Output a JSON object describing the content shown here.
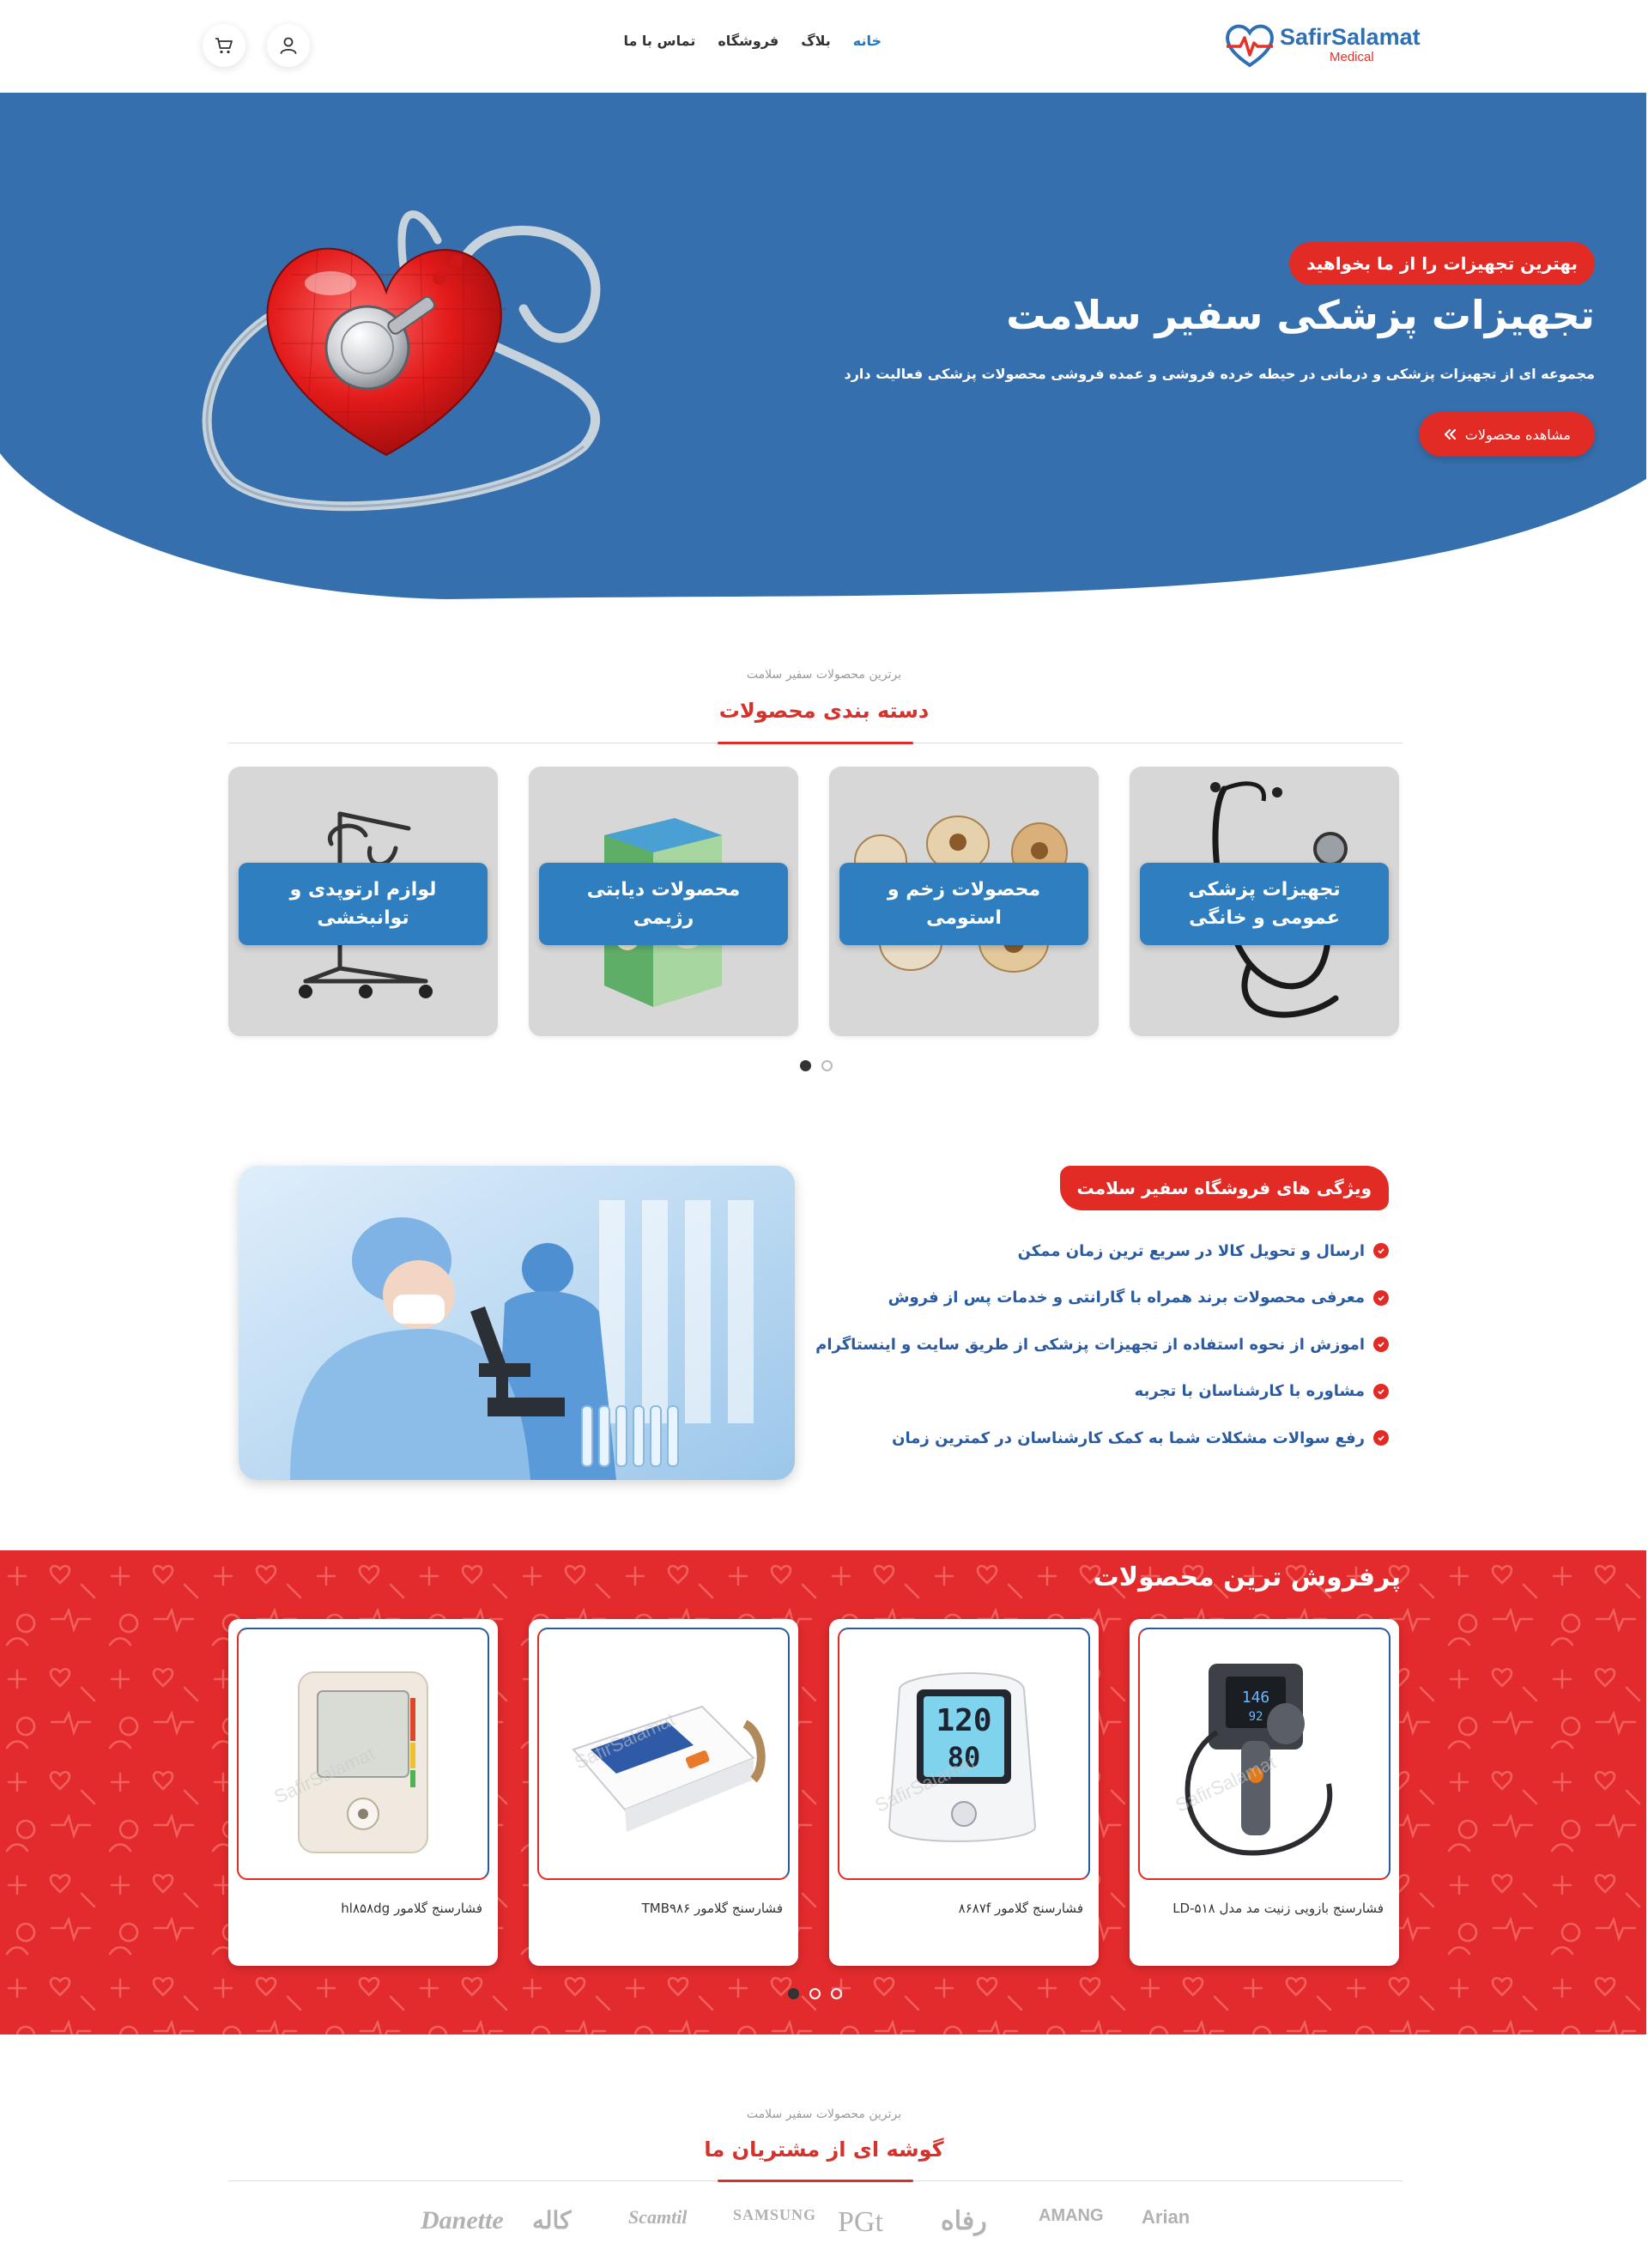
{
  "header": {
    "logo": {
      "brand": "SafirSalamat",
      "sub": "Medical"
    },
    "nav": [
      {
        "label": "خانه",
        "active": true
      },
      {
        "label": "بلاگ",
        "active": false
      },
      {
        "label": "فروشگاه",
        "active": false
      },
      {
        "label": "تماس با ما",
        "active": false
      }
    ],
    "icons": [
      "user-icon",
      "cart-icon"
    ]
  },
  "hero": {
    "badge": "بهترین تجهیزات را از ما بخواهید",
    "title": "تجهیزات پزشکی سفیر سلامت",
    "description": "مجموعه ای از تجهیزات پزشکی و درمانی در حیطه خرده فروشی و عمده فروشی محصولات پزشکی فعالیت دارد",
    "button": "مشاهده محصولات",
    "background_color": "#366fad",
    "accent_color": "#e32b25"
  },
  "categories": {
    "kicker": "برترین محصولات سفیر سلامت",
    "title": "دسته بندی محصولات",
    "items": [
      {
        "label": "تجهیزات پزشکی عمومی و خانگی",
        "icon": "stethoscope"
      },
      {
        "label": "محصولات زخم و استومی",
        "icon": "wound-dressings"
      },
      {
        "label": "محصولات دیابتی رژیمی",
        "icon": "diabetic-food-box"
      },
      {
        "label": "لوازم ارتوپدی و توانبخشی",
        "icon": "patient-lift"
      }
    ],
    "active_page": 1,
    "pages": 2
  },
  "features": {
    "badge": "ویژگی های فروشگاه سفیر سلامت",
    "items": [
      "ارسال و تحویل کالا در سریع ترین زمان ممکن",
      "معرفی محصولات برند همراه با گارانتی و خدمات پس از فروش",
      "اموزش از نحوه استفاده از تجهیزات پزشکی از طریق سایت و اینستاگرام",
      "مشاوره با کارشناسان با تجربه",
      "رفع سوالات مشکلات شما به کمک کارشناسان در کمترین زمان"
    ],
    "image": "laboratory-scientists-microscope"
  },
  "best_sellers": {
    "title": "پرفروش ترین محصولات",
    "watermark": "SafirSalamat",
    "products": [
      {
        "name": "فشارسنج بازویی زنیت مد مدل LD-۵۱۸",
        "icon": "aneroid-bp-monitor"
      },
      {
        "name": "فشارسنج گلامور ۸۶۸۷f",
        "icon": "digital-bp-monitor-blue"
      },
      {
        "name": "فشارسنج گلامور TMB۹۸۶",
        "icon": "digital-bp-monitor-white"
      },
      {
        "name": "فشارسنج گلامور hl۸۵۸dg",
        "icon": "digital-bp-monitor-beige"
      }
    ],
    "active_page": 1,
    "pages": 3,
    "background_color": "#e32b2d"
  },
  "customers": {
    "kicker": "برترین محصولات سفیر سلامت",
    "title": "گوشه ای از مشتریان ما",
    "brands": [
      "Danette",
      "کاله",
      "Scamtil",
      "SAMSUNG",
      "PGt",
      "رفاه",
      "AMANG",
      "Arian"
    ]
  }
}
